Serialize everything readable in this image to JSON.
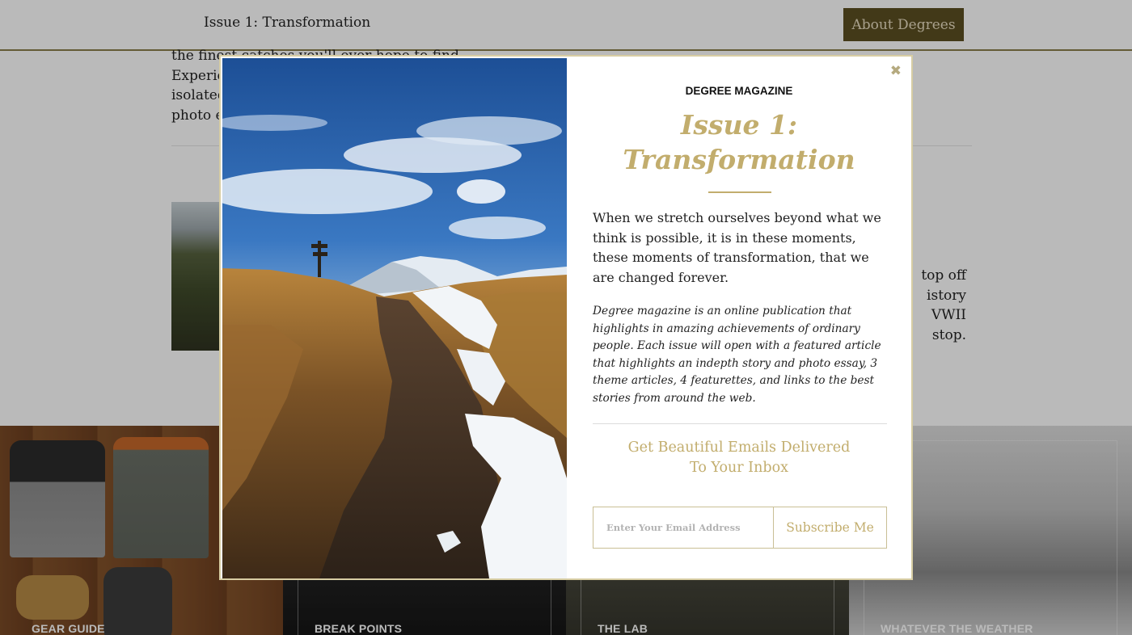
{
  "header": {
    "issue_title": "Issue 1: Transformation",
    "about_button": "About Degrees"
  },
  "background": {
    "intro_lines": [
      "the finest catches you'll ever hope to find. Experience the",
      "isolated",
      "photo es"
    ],
    "right_text_lines": [
      "top off",
      "istory",
      "VWII",
      "stop."
    ],
    "tiles": [
      {
        "label": "GEAR GUIDE"
      },
      {
        "label": "BREAK POINTS"
      },
      {
        "label": "THE LAB"
      },
      {
        "label": "WHATEVER THE WEATHER"
      }
    ]
  },
  "modal": {
    "close_icon": "close-icon",
    "kicker": "DEGREE MAGAZINE",
    "title_line1": "Issue 1:",
    "title_line2": "Transformation",
    "lede": "When we stretch ourselves beyond what we think is possible, it is in these moments, these moments of transformation, that we are changed forever.",
    "description": "Degree magazine is an online publication that highlights in amazing achievements of ordinary people. Each issue will open with a featured article that highlights an indepth story and photo essay, 3 theme articles, 4 featurettes, and links to the best stories from around the web.",
    "promo_line1": "Get Beautiful Emails Delivered",
    "promo_line2": "To Your Inbox",
    "email_placeholder": "Enter Your Email Address",
    "email_value": "",
    "subscribe_label": "Subscribe Me"
  },
  "colors": {
    "accent_gold": "#c2ad6d",
    "header_button": "#5b4f22",
    "overlay": "rgba(0,0,0,0.27)"
  }
}
